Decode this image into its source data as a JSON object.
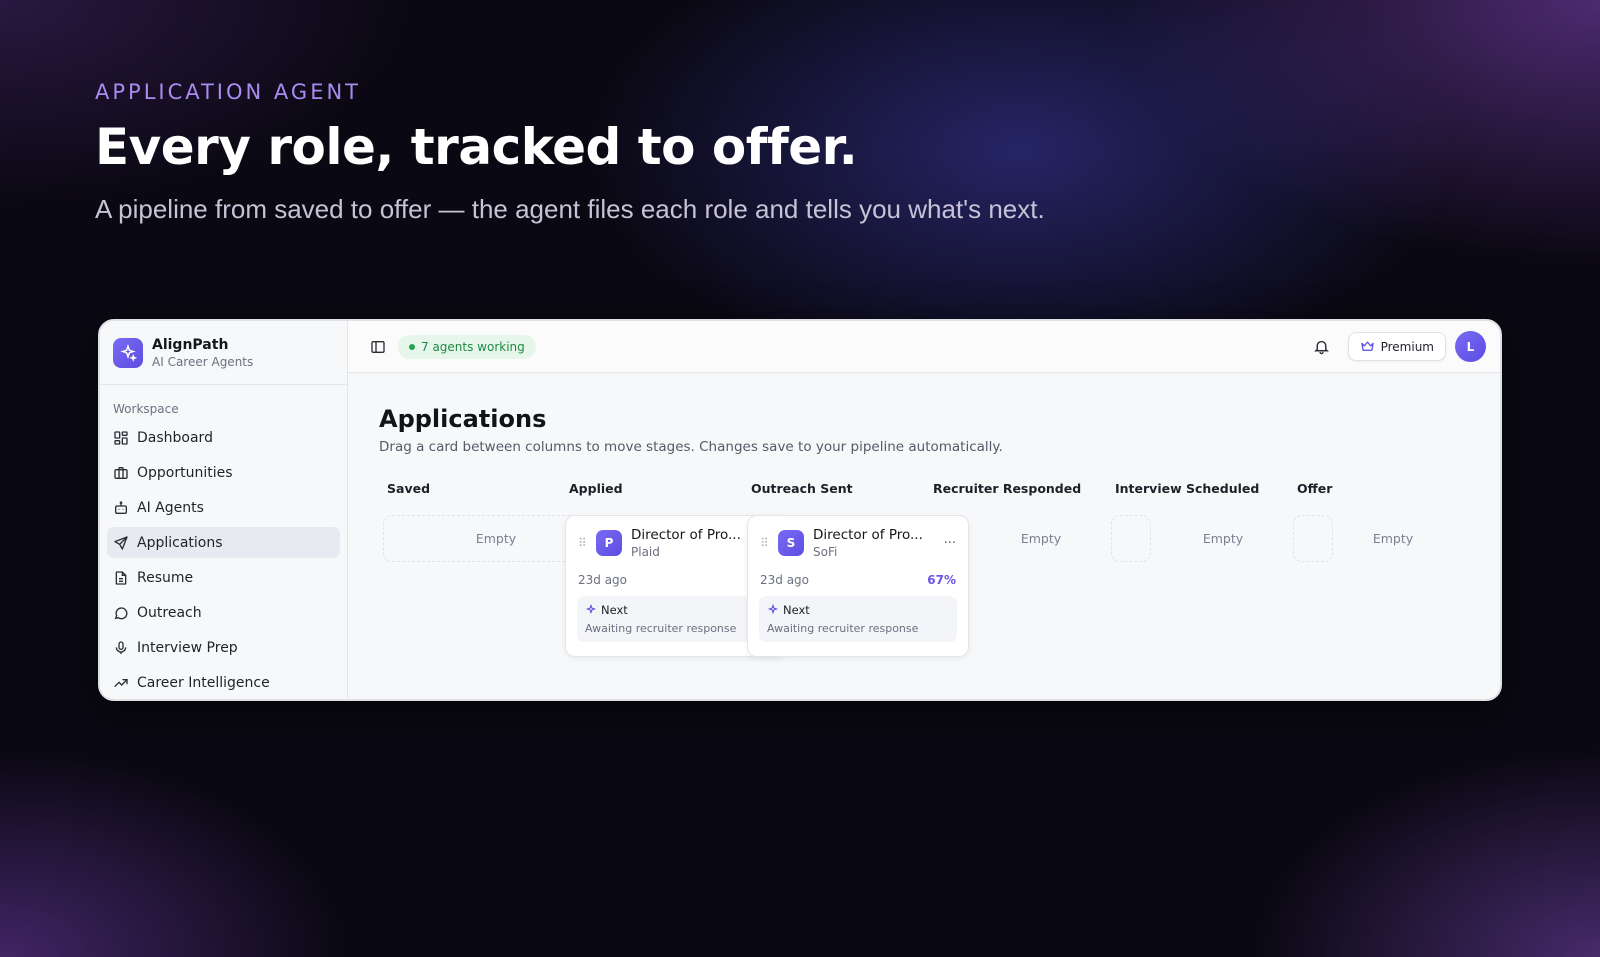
{
  "hero": {
    "eyebrow": "APPLICATION AGENT",
    "headline": "Every role, tracked to offer.",
    "subline": "A pipeline from saved to offer — the agent files each role and tells you what's next."
  },
  "brand": {
    "name": "AlignPath",
    "tagline": "AI Career Agents"
  },
  "sidebar": {
    "section_label": "Workspace",
    "items": [
      {
        "label": "Dashboard",
        "icon": "dashboard-icon"
      },
      {
        "label": "Opportunities",
        "icon": "briefcase-icon"
      },
      {
        "label": "AI Agents",
        "icon": "bot-icon"
      },
      {
        "label": "Applications",
        "icon": "send-icon",
        "active": true
      },
      {
        "label": "Resume",
        "icon": "document-icon"
      },
      {
        "label": "Outreach",
        "icon": "chat-icon"
      },
      {
        "label": "Interview Prep",
        "icon": "microphone-icon"
      },
      {
        "label": "Career Intelligence",
        "icon": "trend-icon"
      }
    ]
  },
  "topbar": {
    "agents_status": "7 agents working",
    "premium_label": "Premium",
    "avatar_initial": "L"
  },
  "page": {
    "title": "Applications",
    "description": "Drag a card between columns to move stages. Changes save to your pipeline automatically."
  },
  "board": {
    "empty_label": "Empty",
    "columns": [
      "Saved",
      "Applied",
      "Outreach Sent",
      "Recruiter Responded",
      "Interview Scheduled",
      "Offer"
    ],
    "cards": [
      {
        "column": "Applied",
        "logo_letter": "P",
        "role": "Director of Pro...",
        "company": "Plaid",
        "age": "23d ago",
        "match": "",
        "next_label": "Next",
        "next_text": "Awaiting recruiter response"
      },
      {
        "column": "Outreach Sent",
        "logo_letter": "S",
        "role": "Director of Pro...",
        "company": "SoFi",
        "age": "23d ago",
        "match": "67%",
        "next_label": "Next",
        "next_text": "Awaiting recruiter response",
        "more_icon": "ellipsis-icon"
      }
    ]
  },
  "colors": {
    "accent": "#6a55e8",
    "status_green": "#27a150"
  }
}
